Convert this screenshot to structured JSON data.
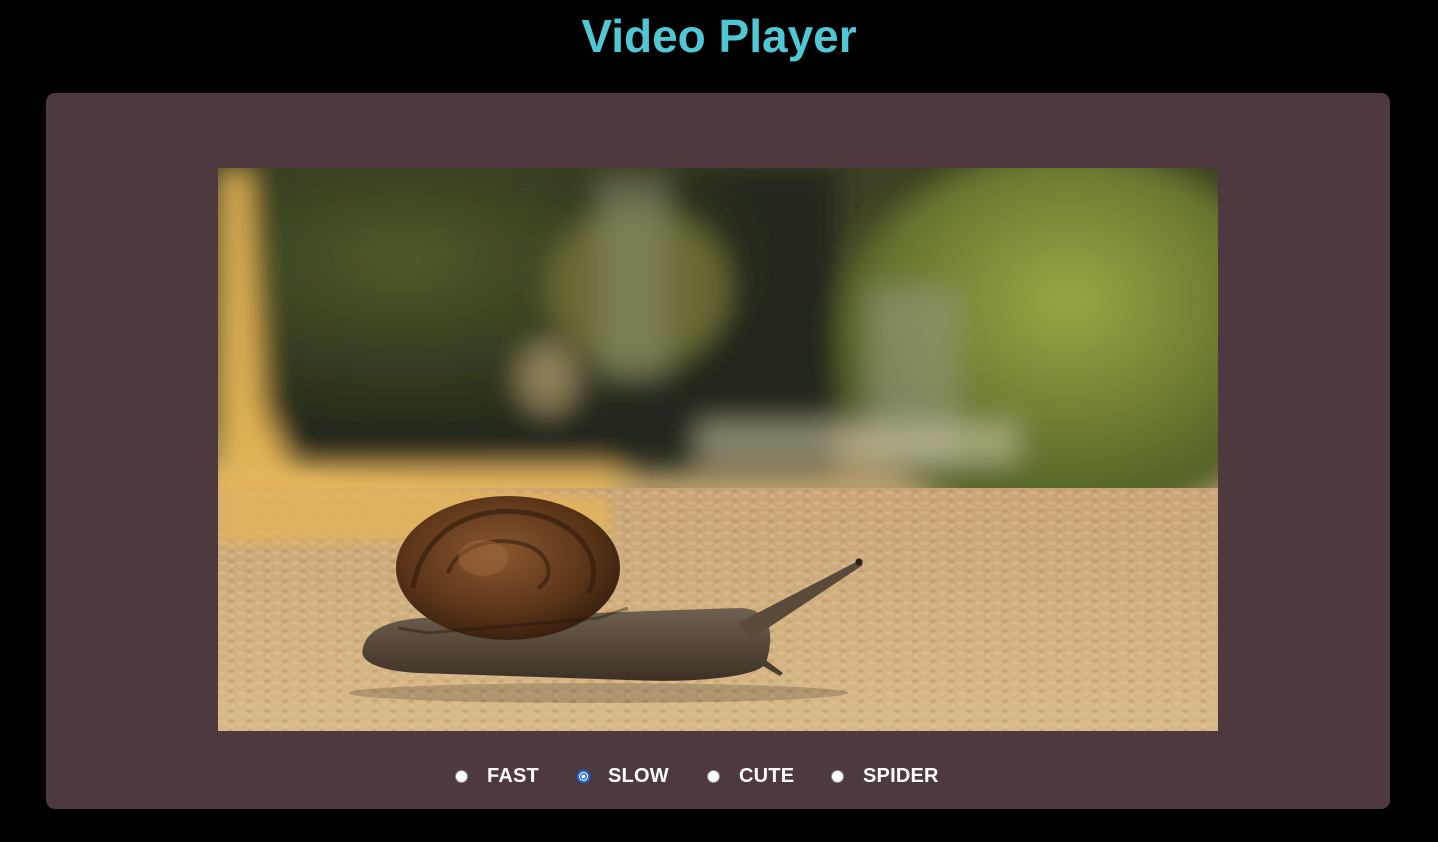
{
  "page": {
    "title": "Video Player",
    "title_color": "#4fc8d4",
    "background": "#000000",
    "panel_color": "#4e393e"
  },
  "video": {
    "subject": "snail crawling on gravel path",
    "icon": "video-frame"
  },
  "speed_options": [
    {
      "label": "FAST",
      "checked": false
    },
    {
      "label": "SLOW",
      "checked": true
    },
    {
      "label": "CUTE",
      "checked": false
    },
    {
      "label": "SPIDER",
      "checked": false
    }
  ],
  "accent_color": "#1a6ce8"
}
